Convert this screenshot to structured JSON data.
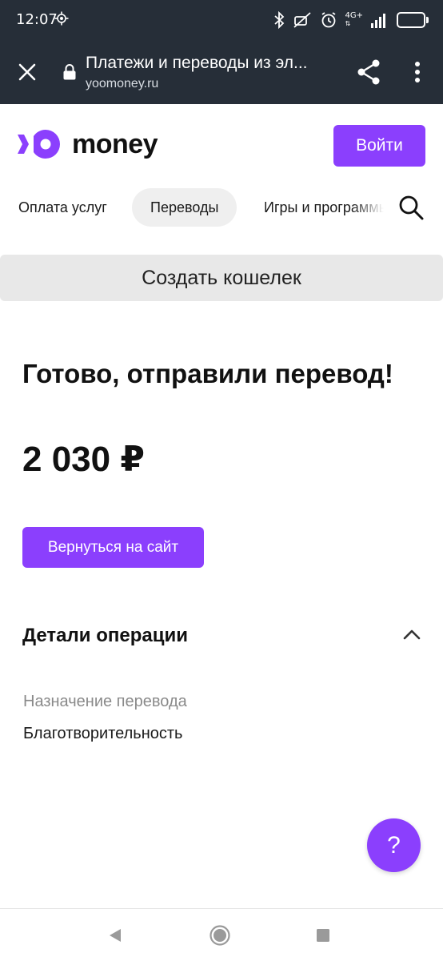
{
  "status_bar": {
    "time": "12:07",
    "network": "4G+",
    "battery": "68"
  },
  "browser": {
    "page_title": "Платежи и переводы из эл...",
    "url": "yoomoney.ru"
  },
  "header": {
    "brand": "money",
    "login_label": "Войти",
    "accent_color": "#8b3ffd"
  },
  "nav": {
    "items": [
      {
        "label": "Оплата услуг"
      },
      {
        "label": "Переводы",
        "active": true
      },
      {
        "label": "Игры и программы"
      }
    ]
  },
  "banner": {
    "create_wallet_label": "Создать кошелек"
  },
  "result": {
    "title": "Готово, отправили перевод!",
    "amount": "2 030 ₽",
    "return_label": "Вернуться на сайт"
  },
  "details": {
    "title": "Детали операции",
    "purpose_label": "Назначение перевода",
    "purpose_value": "Благотворительность"
  },
  "help": {
    "label": "?"
  }
}
